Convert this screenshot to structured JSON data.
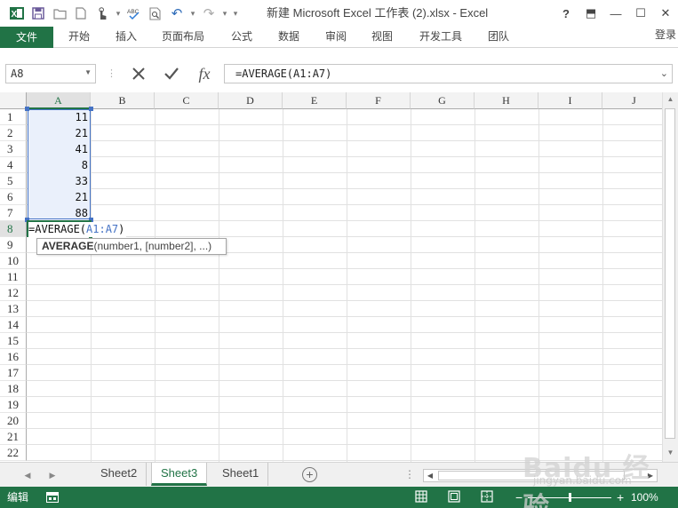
{
  "window": {
    "title": "新建 Microsoft Excel 工作表 (2).xlsx - Excel",
    "help": "?",
    "ribbon_display": "⬒",
    "minimize": "—",
    "maximize": "☐",
    "close": "✕"
  },
  "qat": {
    "excel_icon": "X",
    "save": "💾",
    "open": "📂",
    "new": "📄",
    "touch": "✋",
    "spelling": "ABC",
    "print_preview": "🔍",
    "undo": "↶",
    "redo": "↷",
    "customize": "▾"
  },
  "ribbon": {
    "file": "文件",
    "tabs": [
      "开始",
      "插入",
      "页面布局",
      "公式",
      "数据",
      "审阅",
      "视图",
      "开发工具",
      "团队"
    ],
    "login": "登录"
  },
  "formula_bar": {
    "name_box": "A8",
    "cancel_icon": "✕",
    "enter_icon": "✓",
    "fx_label": "fx",
    "formula": "=AVERAGE(A1:A7)"
  },
  "grid": {
    "columns": [
      "A",
      "B",
      "C",
      "D",
      "E",
      "F",
      "G",
      "H",
      "I",
      "J"
    ],
    "rows": [
      "1",
      "2",
      "3",
      "4",
      "5",
      "6",
      "7",
      "8",
      "9",
      "10",
      "11",
      "12",
      "13",
      "14",
      "15",
      "16",
      "17",
      "18",
      "19",
      "20",
      "21",
      "22"
    ],
    "values_a": [
      "11",
      "21",
      "41",
      "8",
      "33",
      "21",
      "88"
    ],
    "edit": {
      "prefix": "=AVERAGE(",
      "ref": "A1:A7",
      "suffix": ")"
    },
    "tooltip": {
      "func": "AVERAGE",
      "args": "(number1, [number2], ...)"
    }
  },
  "sheets": {
    "tabs": [
      "Sheet2",
      "Sheet3",
      "Sheet1"
    ],
    "active": "Sheet3",
    "add": "+",
    "dots": "⋮"
  },
  "status": {
    "mode": "编辑",
    "zoom": "100%",
    "zoom_minus": "−",
    "zoom_plus": "+"
  },
  "watermark": {
    "line1": "Baidu 经验",
    "line2": "jingyan.baidu.com"
  },
  "colors": {
    "accent": "#217346",
    "range": "#4472c4",
    "range_fill": "#eaf0fb"
  }
}
